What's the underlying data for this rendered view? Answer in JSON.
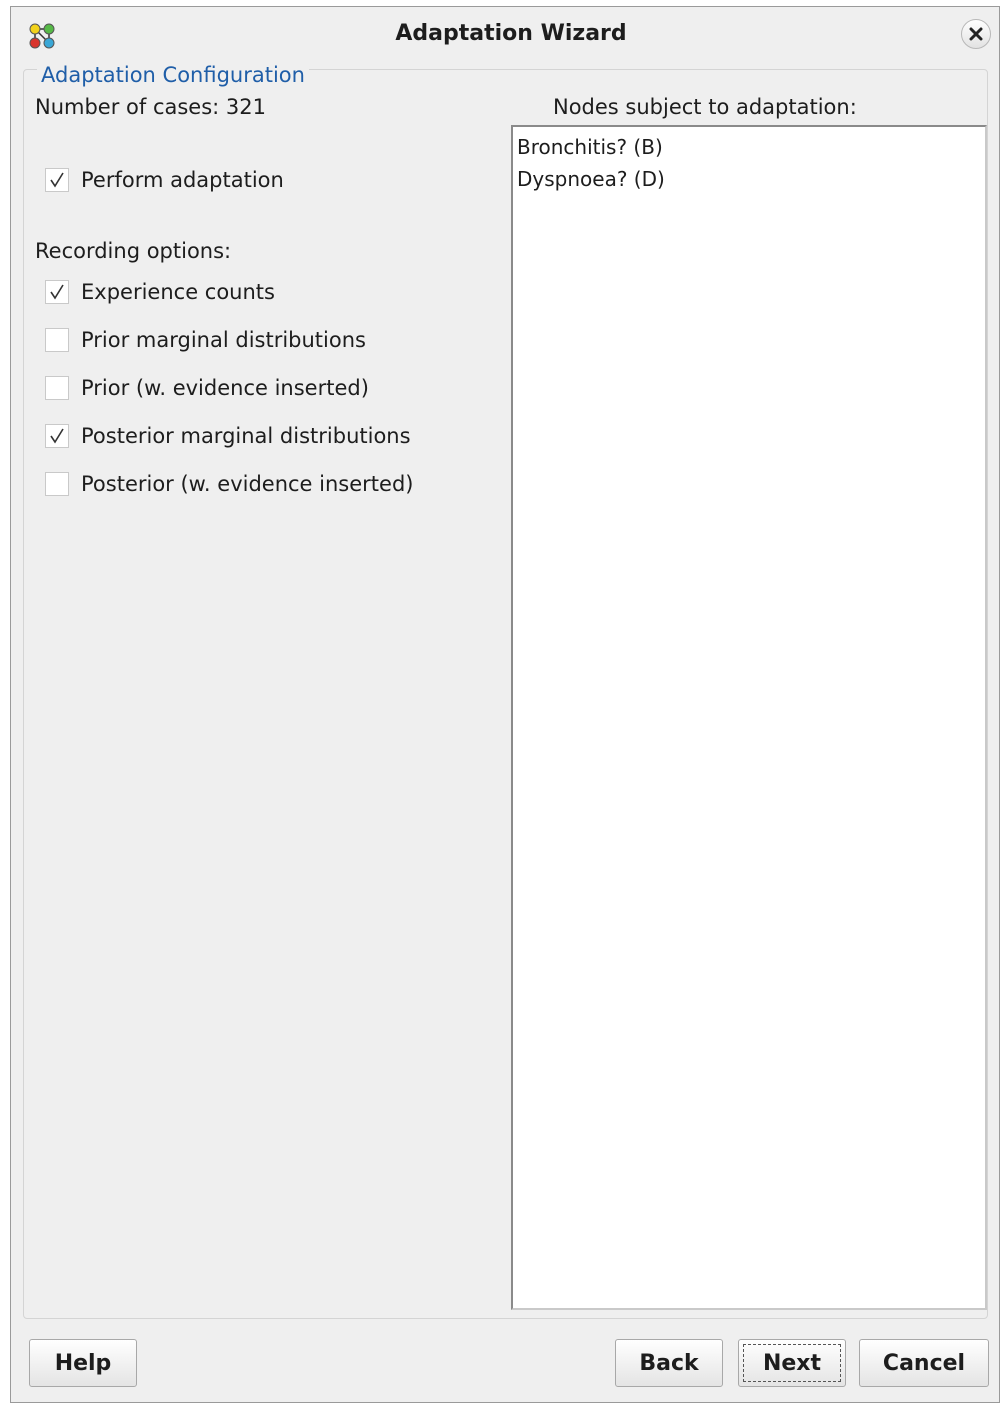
{
  "window": {
    "title": "Adaptation Wizard"
  },
  "config": {
    "section_title": "Adaptation Configuration",
    "number_of_cases": "Number of cases: 321",
    "perform_adaptation": {
      "label": "Perform adaptation",
      "checked": true
    },
    "recording_options_label": "Recording options:",
    "options": [
      {
        "label": "Experience counts",
        "checked": true
      },
      {
        "label": "Prior marginal distributions",
        "checked": false
      },
      {
        "label": "Prior (w. evidence inserted)",
        "checked": false
      },
      {
        "label": "Posterior marginal distributions",
        "checked": true
      },
      {
        "label": "Posterior (w. evidence inserted)",
        "checked": false
      }
    ]
  },
  "nodes": {
    "label": "Nodes subject to adaptation:",
    "items": [
      "Bronchitis? (B)",
      "Dyspnoea? (D)"
    ]
  },
  "buttons": {
    "help": "Help",
    "back": "Back",
    "next": "Next",
    "cancel": "Cancel"
  },
  "icons": {
    "app": "network-graph-icon",
    "close": "close-icon",
    "check": "checkmark-icon"
  }
}
